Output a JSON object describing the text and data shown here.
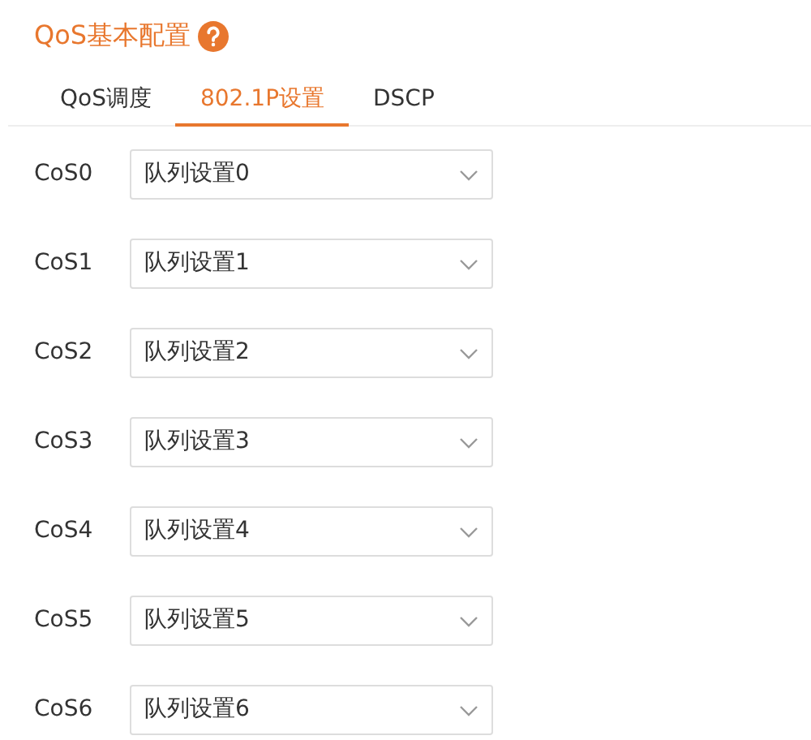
{
  "title": "QoS基本配置",
  "tabs": [
    {
      "label": "QoS调度",
      "selected": false
    },
    {
      "label": "802.1P设置",
      "selected": true
    },
    {
      "label": "DSCP",
      "selected": false
    }
  ],
  "rows": [
    {
      "label": "CoS0",
      "value": "队列设置0"
    },
    {
      "label": "CoS1",
      "value": "队列设置1"
    },
    {
      "label": "CoS2",
      "value": "队列设置2"
    },
    {
      "label": "CoS3",
      "value": "队列设置3"
    },
    {
      "label": "CoS4",
      "value": "队列设置4"
    },
    {
      "label": "CoS5",
      "value": "队列设置5"
    },
    {
      "label": "CoS6",
      "value": "队列设置6"
    }
  ]
}
